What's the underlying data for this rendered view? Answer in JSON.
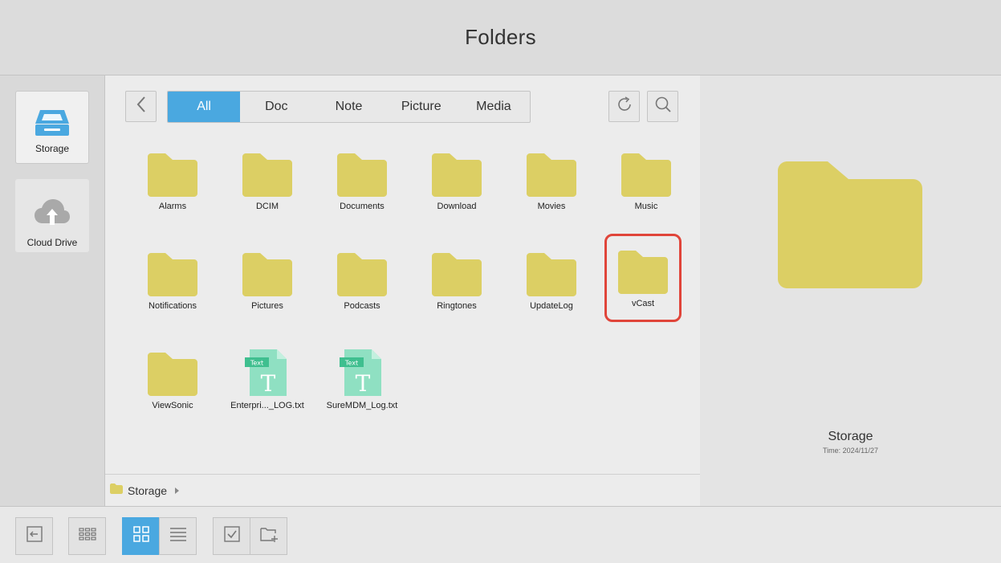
{
  "title": "Folders",
  "sidebar": {
    "items": [
      {
        "label": "Storage",
        "icon": "storage-drive-icon",
        "active": true
      },
      {
        "label": "Cloud Drive",
        "icon": "cloud-upload-icon",
        "active": false
      }
    ]
  },
  "filter_tabs": [
    {
      "label": "All",
      "active": true
    },
    {
      "label": "Doc",
      "active": false
    },
    {
      "label": "Note",
      "active": false
    },
    {
      "label": "Picture",
      "active": false
    },
    {
      "label": "Media",
      "active": false
    }
  ],
  "files": [
    {
      "name": "Alarms",
      "type": "folder"
    },
    {
      "name": "DCIM",
      "type": "folder"
    },
    {
      "name": "Documents",
      "type": "folder"
    },
    {
      "name": "Download",
      "type": "folder"
    },
    {
      "name": "Movies",
      "type": "folder"
    },
    {
      "name": "Music",
      "type": "folder"
    },
    {
      "name": "Notifications",
      "type": "folder"
    },
    {
      "name": "Pictures",
      "type": "folder"
    },
    {
      "name": "Podcasts",
      "type": "folder"
    },
    {
      "name": "Ringtones",
      "type": "folder"
    },
    {
      "name": "UpdateLog",
      "type": "folder"
    },
    {
      "name": "vCast",
      "type": "folder",
      "selected": true
    },
    {
      "name": "ViewSonic",
      "type": "folder"
    },
    {
      "name": "Enterpri..._LOG.txt",
      "type": "text",
      "badge": "Text",
      "glyph": "T"
    },
    {
      "name": "SureMDM_Log.txt",
      "type": "text",
      "badge": "Text",
      "glyph": "T"
    }
  ],
  "breadcrumb": {
    "label": "Storage"
  },
  "preview": {
    "name": "Storage",
    "time": "Time: 2024/11/27"
  },
  "colors": {
    "accent": "#4aa8e0",
    "folder": "#dccf64",
    "text_file": "#8fe0c2",
    "text_badge": "#3fbf8f",
    "selection": "#e0453a"
  },
  "icons": {
    "back": "chevron-left-icon",
    "refresh": "refresh-icon",
    "search": "search-icon",
    "exit": "exit-icon",
    "apps": "apps-grid-icon",
    "grid_view": "grid-view-icon",
    "list_view": "list-view-icon",
    "multi_select": "checkbox-icon",
    "new_folder": "new-folder-icon"
  }
}
